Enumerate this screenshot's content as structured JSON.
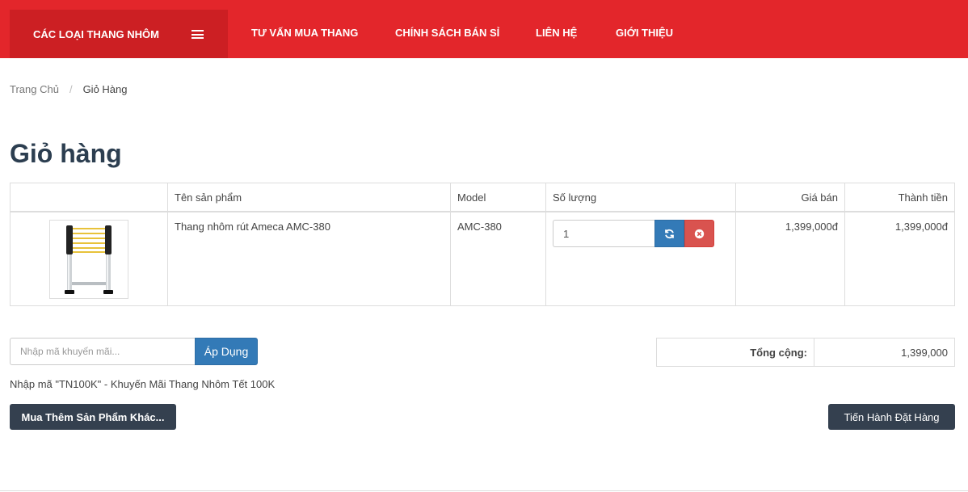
{
  "nav": {
    "category_label": "CÁC LOẠI THANG NHÔM",
    "items": [
      {
        "label": "TƯ VẤN MUA THANG"
      },
      {
        "label": "CHÍNH SÁCH BÁN SỈ"
      },
      {
        "label": "LIÊN HỆ"
      },
      {
        "label": "GIỚI THIỆU"
      }
    ]
  },
  "breadcrumb": {
    "home": "Trang Chủ",
    "separator": "/",
    "current": "Giỏ Hàng"
  },
  "page_title": "Giỏ hàng",
  "cart": {
    "headers": {
      "image": "",
      "name": "Tên sản phẩm",
      "model": "Model",
      "quantity": "Số lượng",
      "price": "Giá bán",
      "total": "Thành tiền"
    },
    "rows": [
      {
        "name": "Thang nhôm rút Ameca AMC-380",
        "model": "AMC-380",
        "quantity": "1",
        "price": "1,399,000đ",
        "total": "1,399,000đ"
      }
    ]
  },
  "coupon": {
    "placeholder": "Nhập mã khuyến mãi...",
    "apply_label": "Áp Dụng",
    "note": "Nhập mã \"TN100K\" - Khuyến Mãi Thang Nhôm Tết 100K"
  },
  "totals": {
    "label": "Tổng cộng:",
    "value": "1,399,000"
  },
  "actions": {
    "continue_label": "Mua Thêm Sản Phẩm Khác...",
    "checkout_label": "Tiến Hành Đặt Hàng"
  },
  "colors": {
    "brand_red": "#e3262b",
    "brand_red_dark": "#cc1f23",
    "primary_blue": "#337ab7",
    "danger_red": "#d9534f",
    "dark_button": "#34404f"
  }
}
